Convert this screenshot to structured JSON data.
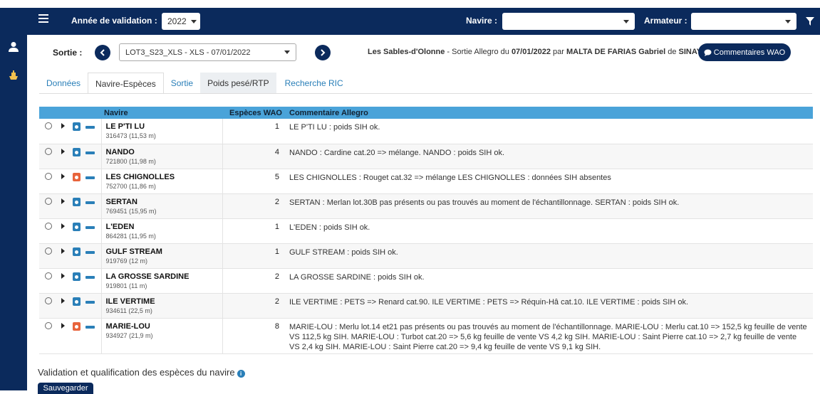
{
  "topbar": {
    "year_label": "Année de validation :",
    "year_value": "2022",
    "navire_label": "Navire :",
    "navire_value": "",
    "armateur_label": "Armateur :",
    "armateur_value": ""
  },
  "sortie": {
    "label": "Sortie :",
    "selected": "LOT3_S23_XLS - XLS - 07/01/2022",
    "info": {
      "port": "Les Sables-d'Olonne",
      "text1": " - Sortie Allegro du ",
      "date": "07/01/2022",
      "text2": " par ",
      "person": "MALTA DE FARIAS Gabriel",
      "text3": " de ",
      "org": "SINAY"
    },
    "comments_button": "Commentaires WAO"
  },
  "tabs": [
    {
      "label": "Données"
    },
    {
      "label": "Navire-Espèces"
    },
    {
      "label": "Sortie"
    },
    {
      "label": "Poids pesé/RTP"
    },
    {
      "label": "Recherche RIC"
    }
  ],
  "table": {
    "headers": {
      "navire": "Navire",
      "especes": "Espèces WAO",
      "commentaire": "Commentaire Allegro"
    },
    "rows": [
      {
        "name": "LE P'TI LU",
        "sub": "316473 (11,53 m)",
        "count": "1",
        "comment": "LE P'TI LU : poids SIH ok.",
        "status": "ok"
      },
      {
        "name": "NANDO",
        "sub": "721800 (11,98 m)",
        "count": "4",
        "comment": "NANDO : Cardine cat.20 => mélange. NANDO : poids SIH ok.",
        "status": "ok"
      },
      {
        "name": "LES CHIGNOLLES",
        "sub": "752700 (11,86 m)",
        "count": "5",
        "comment": "LES CHIGNOLLES : Rouget cat.32 => mélange LES CHIGNOLLES : données SIH absentes",
        "status": "warn"
      },
      {
        "name": "SERTAN",
        "sub": "769451 (15,95 m)",
        "count": "2",
        "comment": "SERTAN : Merlan lot.30B pas présents ou pas trouvés au moment de l'échantillonnage. SERTAN : poids SIH ok.",
        "status": "ok"
      },
      {
        "name": "L'EDEN",
        "sub": "864281 (11,95 m)",
        "count": "1",
        "comment": "L'EDEN : poids SIH ok.",
        "status": "ok"
      },
      {
        "name": "GULF STREAM",
        "sub": "919769 (12 m)",
        "count": "1",
        "comment": "GULF STREAM : poids SIH ok.",
        "status": "ok"
      },
      {
        "name": "LA GROSSE SARDINE",
        "sub": "919801 (11 m)",
        "count": "2",
        "comment": "LA GROSSE SARDINE : poids SIH ok.",
        "status": "ok"
      },
      {
        "name": "ILE VERTIME",
        "sub": "934611 (22,5 m)",
        "count": "2",
        "comment": "ILE VERTIME : PETS => Renard cat.90. ILE VERTIME : PETS => Réquin-Hâ cat.10. ILE VERTIME : poids SIH ok.",
        "status": "ok"
      },
      {
        "name": "MARIE-LOU",
        "sub": "934927 (21,9 m)",
        "count": "8",
        "comment": "MARIE-LOU : Merlu lot.14 et21 pas présents ou pas trouvés au moment de l'échantillonnage. MARIE-LOU : Merlu cat.10 => 152,5 kg feuille de vente VS 112,5 kg SIH. MARIE-LOU : Turbot cat.20 => 5,6 kg feuille de vente VS 4,2 kg SIH. MARIE-LOU : Saint Pierre cat.10 => 2,7 kg feuille de vente VS 2,4 kg SIH. MARIE-LOU : Saint Pierre cat.20 => 9,4 kg feuille de vente VS 9,1 kg SIH.",
        "status": "warn"
      }
    ]
  },
  "colors": {
    "nav": "#0b2a5c",
    "header": "#4aa3d9",
    "ok": "#2a7fb8",
    "warn": "#e8643c"
  },
  "validation": {
    "title": "Validation et qualification des espèces du navire",
    "save": "Sauvegarder"
  }
}
